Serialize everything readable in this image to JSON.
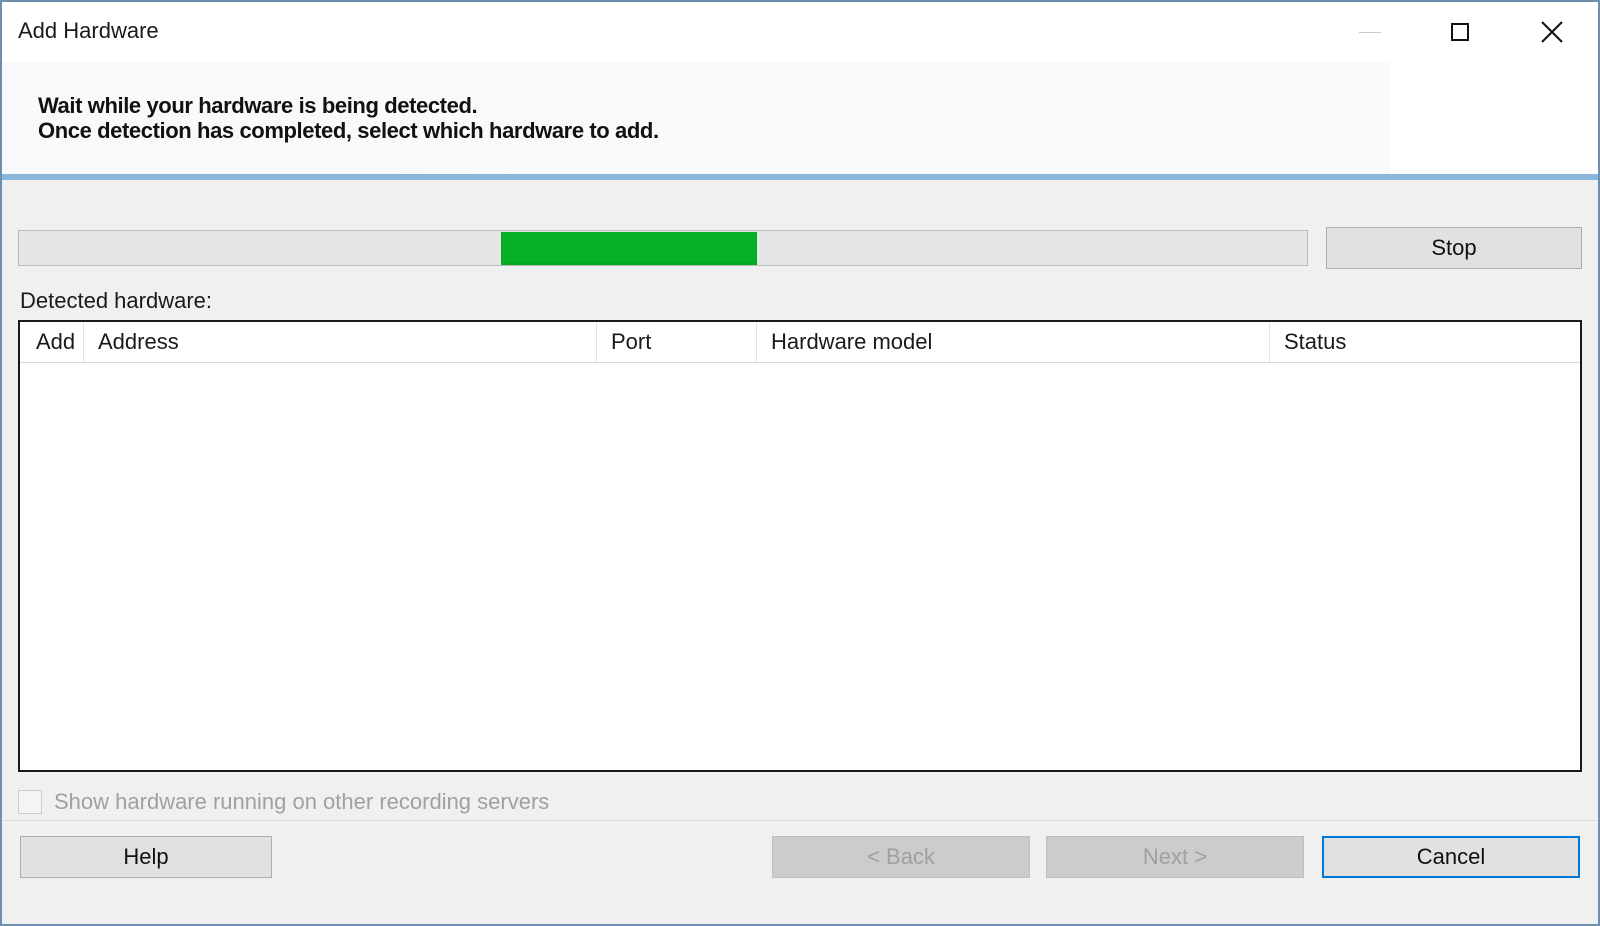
{
  "window": {
    "title": "Add Hardware",
    "controls": {
      "minimize_icon": "minimize-icon",
      "maximize_icon": "maximize-icon",
      "close_icon": "close-icon"
    }
  },
  "header": {
    "line1": "Wait while your hardware is being detected.",
    "line2": "Once detection has completed, select which hardware to add."
  },
  "progress": {
    "start_fraction": 0.374,
    "end_fraction": 0.573,
    "color": "#06b025"
  },
  "stop_button": {
    "label": "Stop"
  },
  "detected_label": "Detected hardware:",
  "table": {
    "columns": [
      "Add",
      "Address",
      "Port",
      "Hardware model",
      "Status"
    ],
    "rows": []
  },
  "show_other_servers": {
    "label": "Show hardware running on other recording servers",
    "checked": false,
    "enabled": false
  },
  "footer": {
    "help_label": "Help",
    "back_label": "< Back",
    "next_label": "Next >",
    "cancel_label": "Cancel"
  },
  "colors": {
    "accent": "#0078d7",
    "header_divider": "#8bb6dc",
    "window_border": "#6d8fb0"
  }
}
